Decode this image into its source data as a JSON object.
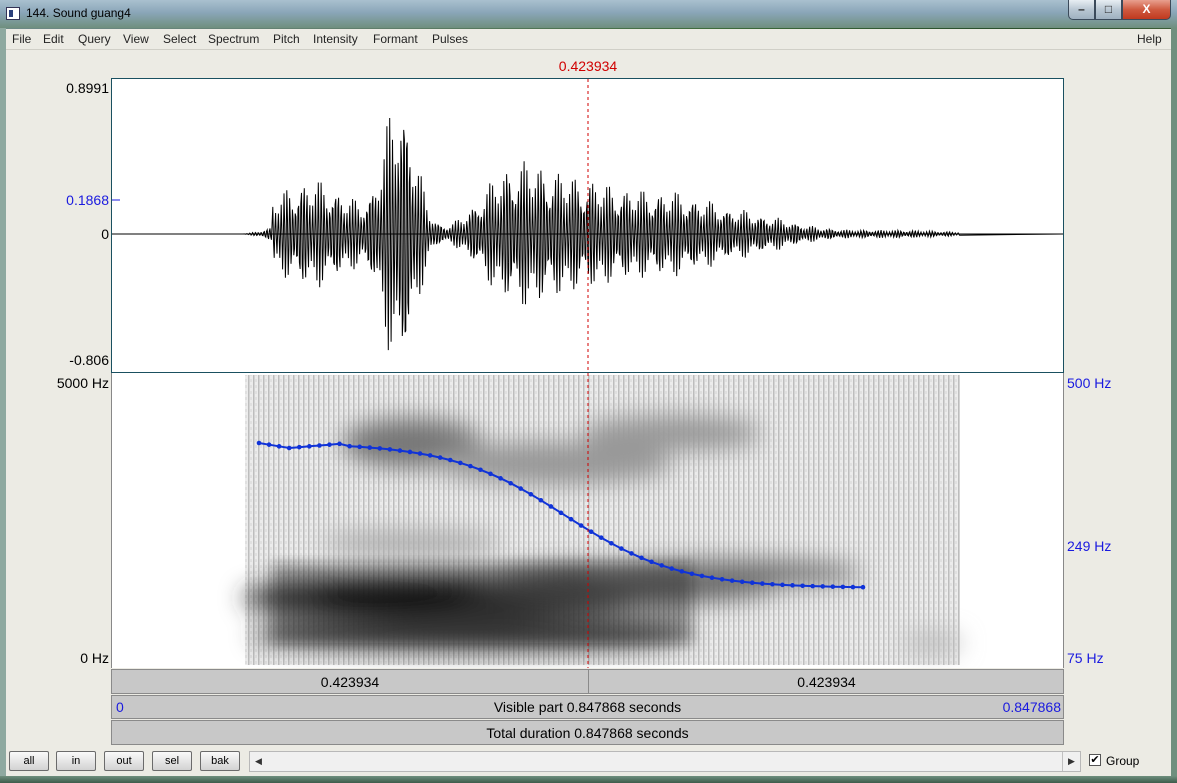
{
  "window": {
    "title": "144. Sound guang4",
    "minimize_label": "–",
    "maximize_label": "□",
    "close_label": "X"
  },
  "menu": {
    "items": [
      "File",
      "Edit",
      "Query",
      "View",
      "Select",
      "Spectrum",
      "Pitch",
      "Intensity",
      "Formant",
      "Pulses"
    ],
    "help": "Help"
  },
  "cursor_time": "0.423934",
  "waveform": {
    "y_max": "0.8991",
    "y_mid": "0.1868",
    "y_zero": "0",
    "y_min": "-0.806"
  },
  "spectrogram": {
    "freq_top": "5000 Hz",
    "freq_bottom": "0 Hz",
    "pitch_top": "500 Hz",
    "pitch_mid": "249 Hz",
    "pitch_bottom": "75 Hz",
    "pitch_curve_color": "#1033d8"
  },
  "time_bars": {
    "left_segment": "0.423934",
    "right_segment": "0.423934",
    "visible_start": "0",
    "visible_text": "Visible part 0.847868 seconds",
    "visible_end": "0.847868",
    "total_text": "Total duration 0.847868 seconds"
  },
  "bottom": {
    "buttons": [
      "all",
      "in",
      "out",
      "sel",
      "bak"
    ],
    "scroll_left_icon": "◀",
    "scroll_right_icon": "▶",
    "group_checked": true,
    "group_check_mark": "✔",
    "group_label": "Group"
  },
  "colors": {
    "cursor": "#d00000",
    "axis_blue": "#1a1adf",
    "waveform": "#000000"
  }
}
